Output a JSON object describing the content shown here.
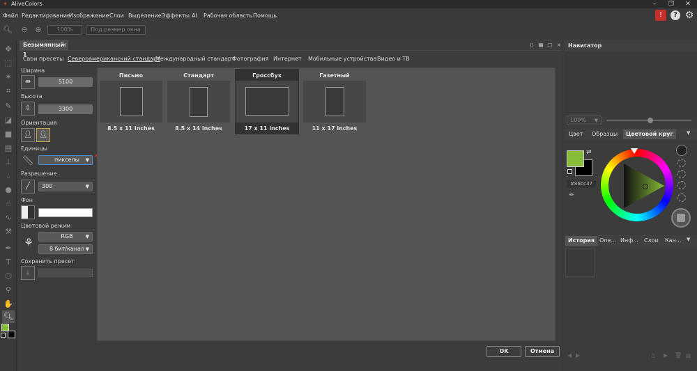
{
  "window": {
    "title": "AliveColors",
    "app_icon": "alivecolors-logo-icon"
  },
  "menu": [
    "Файл",
    "Редактирование",
    "Изображение",
    "Слои",
    "Выделение",
    "Эффекты",
    "AI",
    "Рабочая область",
    "Помощь"
  ],
  "toolbar": {
    "zoom_value": "100%",
    "fit_label": "Под размер окна"
  },
  "document": {
    "tab_title": "Безымянный 1"
  },
  "preset_tabs": [
    "Свои пресеты",
    "Североамериканский стандарт",
    "Международный стандарт",
    "Фотография",
    "Интернет",
    "Мобильные устройства",
    "Видео и ТВ"
  ],
  "active_preset_tab": 1,
  "settings": {
    "width_label": "Ширина",
    "width_value": "5100",
    "height_label": "Высота",
    "height_value": "3300",
    "orientation_label": "Ориентация",
    "units_label": "Единицы",
    "units_value": "пикселы",
    "resolution_label": "Разрешение",
    "resolution_value": "300",
    "background_label": "Фон",
    "background_color": "#ffffff",
    "color_mode_label": "Цветовой режим",
    "color_mode_value": "RGB",
    "bit_depth_value": "8 бит/канал",
    "save_preset_label": "Сохранить пресет",
    "save_preset_value": ""
  },
  "presets": [
    {
      "title": "Письмо",
      "caption": "8.5 x 11 inches",
      "selected": false
    },
    {
      "title": "Стандарт",
      "caption": "8.5 x 14 inches",
      "selected": false
    },
    {
      "title": "Гроссбух",
      "caption": "17 x 11 inches",
      "selected": true
    },
    {
      "title": "Газетный",
      "caption": "11 x 17 inches",
      "selected": false
    }
  ],
  "buttons": {
    "ok": "OK",
    "cancel": "Отмена"
  },
  "navigator": {
    "title": "Навигатор",
    "zoom": "100%"
  },
  "color_panel": {
    "tabs": [
      "Цвет",
      "Образцы",
      "Цветовой круг"
    ],
    "active_tab": 2,
    "foreground": "#86bc37",
    "background": "#000000",
    "hex_label": "#86bc37"
  },
  "history_panel": {
    "tabs": [
      "История",
      "Опе...",
      "Инф...",
      "Слои",
      "Кан..."
    ]
  },
  "colors": {
    "accent_arrow": "#e0262a",
    "selected_border": "#4d8fd6",
    "fg_swatch": "#86bc37"
  }
}
